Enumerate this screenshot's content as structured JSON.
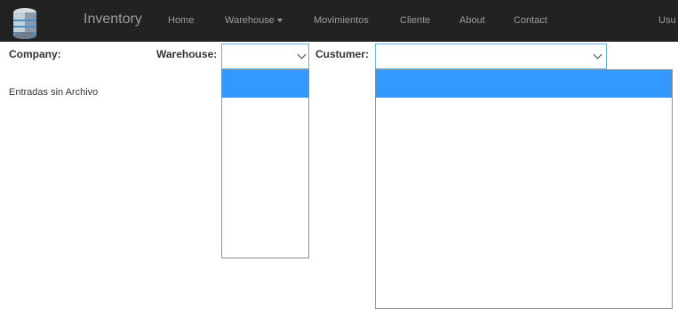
{
  "navbar": {
    "brand": "Inventory",
    "items": [
      {
        "label": "Home"
      },
      {
        "label": "Warehouse"
      },
      {
        "label": "Movimientos"
      },
      {
        "label": "Cliente"
      },
      {
        "label": "About"
      },
      {
        "label": "Contact"
      }
    ],
    "user_partial": "Usu"
  },
  "filters": {
    "company_label": "Company:",
    "warehouse_label": "Warehouse:",
    "customer_label": "Custumer:",
    "warehouse_value": "",
    "customer_value": ""
  },
  "content": {
    "entries_text": "Entradas sin Archivo"
  },
  "colors": {
    "navbar_bg": "#222222",
    "nav_text": "#9d9d9d",
    "selected_option": "#3399ff",
    "focus_border": "#66afe9"
  }
}
